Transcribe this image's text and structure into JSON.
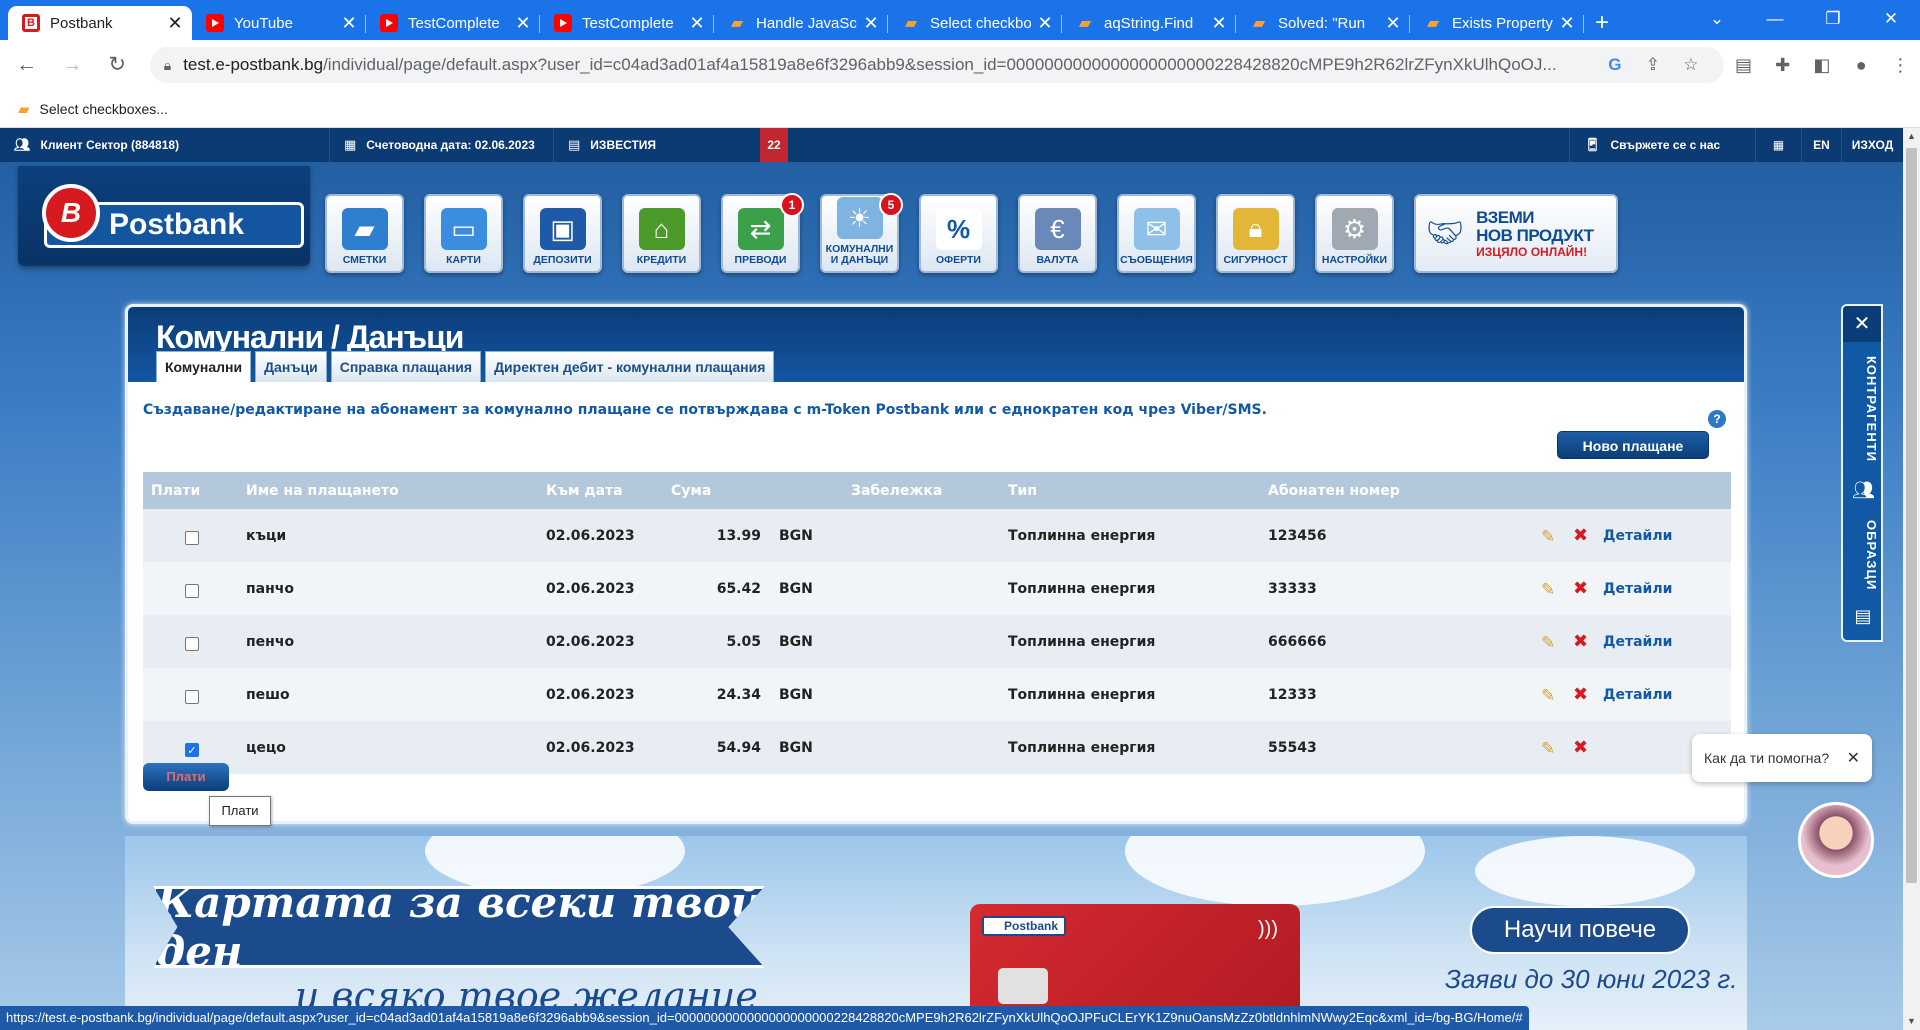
{
  "browser": {
    "tabs": [
      {
        "title": "Postbank",
        "favicon": "postbank-icon",
        "active": true
      },
      {
        "title": "YouTube",
        "favicon": "youtube-icon"
      },
      {
        "title": "TestComplete",
        "favicon": "youtube-icon"
      },
      {
        "title": "TestComplete",
        "favicon": "youtube-icon"
      },
      {
        "title": "Handle JavaSc",
        "favicon": "smartbear-icon"
      },
      {
        "title": "Select checkbo",
        "favicon": "smartbear-icon"
      },
      {
        "title": "aqString.Find",
        "favicon": "smartbear-icon"
      },
      {
        "title": "Solved: \"Run",
        "favicon": "smartbear-icon"
      },
      {
        "title": "Exists Property",
        "favicon": "smartbear-icon"
      }
    ],
    "url_host": "test.e-postbank.bg",
    "url_rest": "/individual/page/default.aspx?user_id=c04ad3ad01af4a15819a8e6f3296abb9&session_id=0000000000000000000000228428820cMPE9h2R62lrZFynXkUlhQoOJ...",
    "bookmark": "Select checkboxes...",
    "status_url": "https://test.e-postbank.bg/individual/page/default.aspx?user_id=c04ad3ad01af4a15819a8e6f3296abb9&session_id=0000000000000000000000228428820cMPE9h2R62lrZFynXkUlhQoOJPFuCLErYK1Z9nuOansMzZz0btldnhlmNWwy2Eqc&xml_id=/bg-BG/Home/#"
  },
  "topbar": {
    "client": "Клиент Сектор (884818)",
    "accounting_date": "Счетоводна дата: 02.06.2023",
    "news": "ИЗВЕСТИЯ",
    "news_count": "22",
    "contact": "Свържете се с нас",
    "lang": "EN",
    "logout": "ИЗХОД"
  },
  "logo": {
    "text": "Postbank"
  },
  "nav": [
    {
      "label": "СМЕТКИ",
      "icon": "wallet-icon"
    },
    {
      "label": "КАРТИ",
      "icon": "card-icon"
    },
    {
      "label": "ДЕПОЗИТИ",
      "icon": "safe-icon"
    },
    {
      "label": "КРЕДИТИ",
      "icon": "house-icon"
    },
    {
      "label": "ПРЕВОДИ",
      "icon": "transfer-icon",
      "badge": "1"
    },
    {
      "label": "КОМУНАЛНИ И ДАНЪЦИ",
      "icon": "bulb-icon",
      "badge": "5"
    },
    {
      "label": "ОФЕРТИ",
      "icon": "percent-icon"
    },
    {
      "label": "ВАЛУТА",
      "icon": "euro-icon"
    },
    {
      "label": "СЪОБЩЕНИЯ",
      "icon": "envelope-icon"
    },
    {
      "label": "СИГУРНОСТ",
      "icon": "lock-icon"
    },
    {
      "label": "НАСТРОЙКИ",
      "icon": "gear-icon"
    }
  ],
  "promo": {
    "line1": "ВЗЕМИ",
    "line2": "НОВ ПРОДУКТ",
    "line3": "ИЗЦЯЛО ОНЛАЙН!"
  },
  "panel": {
    "title": "Комунални / Данъци",
    "tabs": [
      "Комунални",
      "Данъци",
      "Справка плащания",
      "Директен дебит - комунални плащания"
    ],
    "info": "Създаване/редактиране на абонамент за комунално плащане се потвърждава с m-Token Postbank или с еднократен код чрез Viber/SMS.",
    "new_payment": "Ново плащане",
    "help": "?",
    "columns": [
      "Плати",
      "Име на плащането",
      "Към дата",
      "Сума",
      "Забележка",
      "Тип",
      "Абонатен номер"
    ],
    "rows": [
      {
        "name": "къци",
        "date": "02.06.2023",
        "amount": "13.99",
        "currency": "BGN",
        "note": "",
        "type": "Топлинна енергия",
        "account": "123456",
        "checked": false,
        "details": "Детайли"
      },
      {
        "name": "панчо",
        "date": "02.06.2023",
        "amount": "65.42",
        "currency": "BGN",
        "note": "",
        "type": "Топлинна енергия",
        "account": "33333",
        "checked": false,
        "details": "Детайли"
      },
      {
        "name": "пенчо",
        "date": "02.06.2023",
        "amount": "5.05",
        "currency": "BGN",
        "note": "",
        "type": "Топлинна енергия",
        "account": "666666",
        "checked": false,
        "details": "Детайли"
      },
      {
        "name": "пешо",
        "date": "02.06.2023",
        "amount": "24.34",
        "currency": "BGN",
        "note": "",
        "type": "Топлинна енергия",
        "account": "12333",
        "checked": false,
        "details": "Детайли"
      },
      {
        "name": "цецо",
        "date": "02.06.2023",
        "amount": "54.94",
        "currency": "BGN",
        "note": "",
        "type": "Топлинна енергия",
        "account": "55543",
        "checked": true,
        "details": ""
      }
    ],
    "pay_button": "Плати",
    "pay_tooltip": "Плати"
  },
  "side": {
    "contacts": "КОНТРАГЕНТИ",
    "templates": "ОБРАЗЦИ",
    "close": "✕"
  },
  "banner": {
    "headline": "Картата за всеки твой ден",
    "subline": "и всяко твое желание",
    "card_logo": "Postbank",
    "cta": "Научи повече",
    "deadline": "Заяви до 30 юни 2023 г."
  },
  "chat": {
    "prompt": "Как да ти помогна?"
  }
}
